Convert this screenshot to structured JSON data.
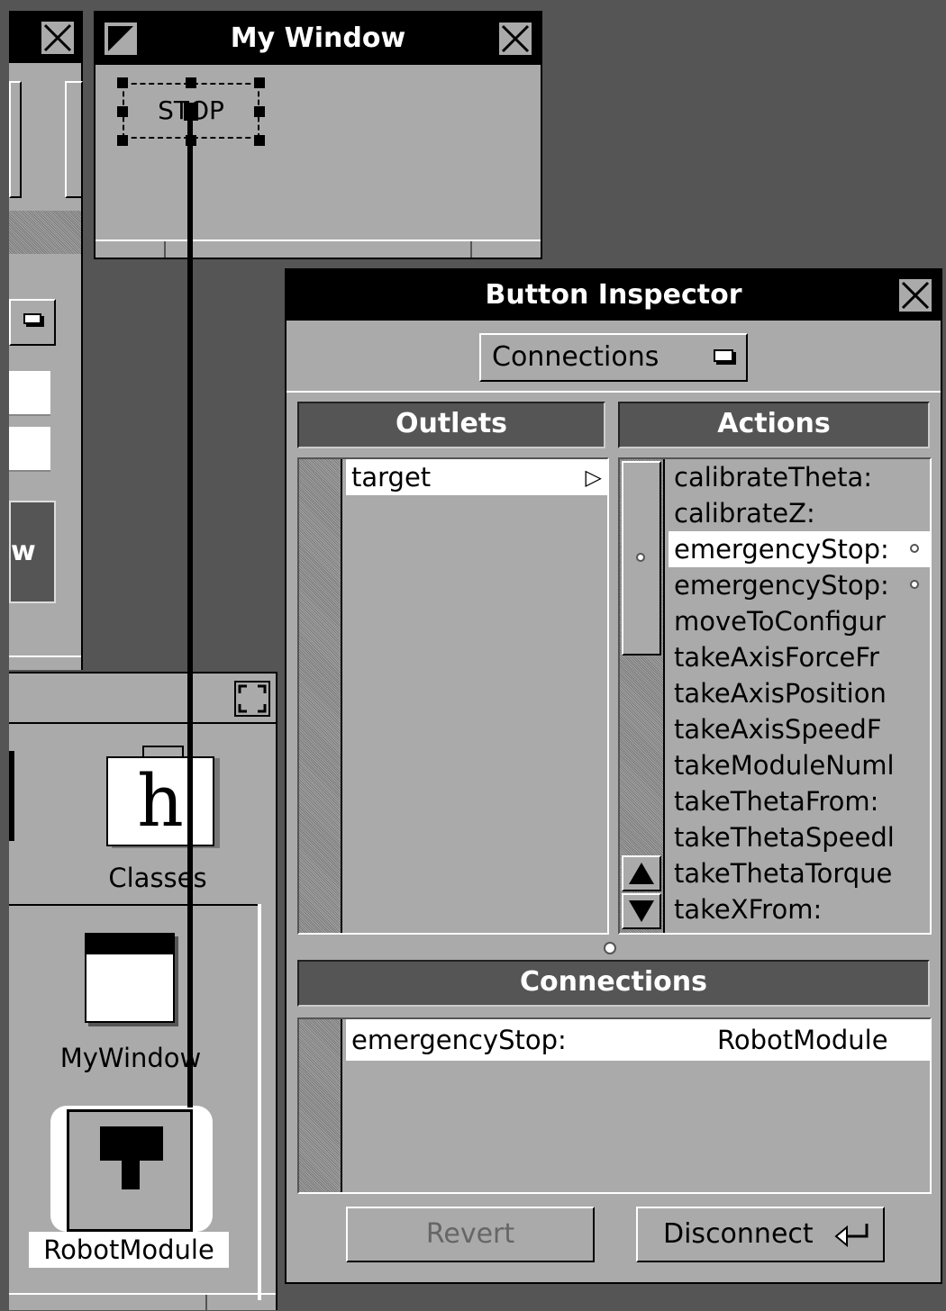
{
  "my_window": {
    "title": "My Window",
    "stop_button_label": "STOP"
  },
  "left_window": {
    "partial_button_text": "w"
  },
  "file_window": {
    "classes_label": "Classes",
    "classes_icon_letter": "h",
    "mywindow_label": "MyWindow",
    "robotmodule_label": "RobotModule"
  },
  "inspector": {
    "title": "Button Inspector",
    "mode_popup": "Connections",
    "outlets_header": "Outlets",
    "actions_header": "Actions",
    "outlets": [
      {
        "name": "target",
        "selected": true
      }
    ],
    "actions": [
      {
        "name": "calibrateTheta:",
        "selected": false,
        "connected": false
      },
      {
        "name": "calibrateZ:",
        "selected": false,
        "connected": false
      },
      {
        "name": "emergencyStop:",
        "selected": true,
        "connected": true
      },
      {
        "name": "emergencyStop:",
        "selected": false,
        "connected": true
      },
      {
        "name": "moveToConfigur",
        "selected": false,
        "connected": false
      },
      {
        "name": "takeAxisForceFr",
        "selected": false,
        "connected": false
      },
      {
        "name": "takeAxisPosition",
        "selected": false,
        "connected": false
      },
      {
        "name": "takeAxisSpeedF",
        "selected": false,
        "connected": false
      },
      {
        "name": "takeModuleNuml",
        "selected": false,
        "connected": false
      },
      {
        "name": "takeThetaFrom:",
        "selected": false,
        "connected": false
      },
      {
        "name": "takeThetaSpeedl",
        "selected": false,
        "connected": false
      },
      {
        "name": "takeThetaTorque",
        "selected": false,
        "connected": false
      },
      {
        "name": "takeXFrom:",
        "selected": false,
        "connected": false
      }
    ],
    "connections_header": "Connections",
    "connections": [
      {
        "action": "emergencyStop:",
        "target": "RobotModule"
      }
    ],
    "revert_label": "Revert",
    "disconnect_label": "Disconnect"
  },
  "colors": {
    "desktop": "#555555",
    "panel": "#aaaaaa",
    "title_bar": "#000000",
    "selection": "#ffffff"
  }
}
